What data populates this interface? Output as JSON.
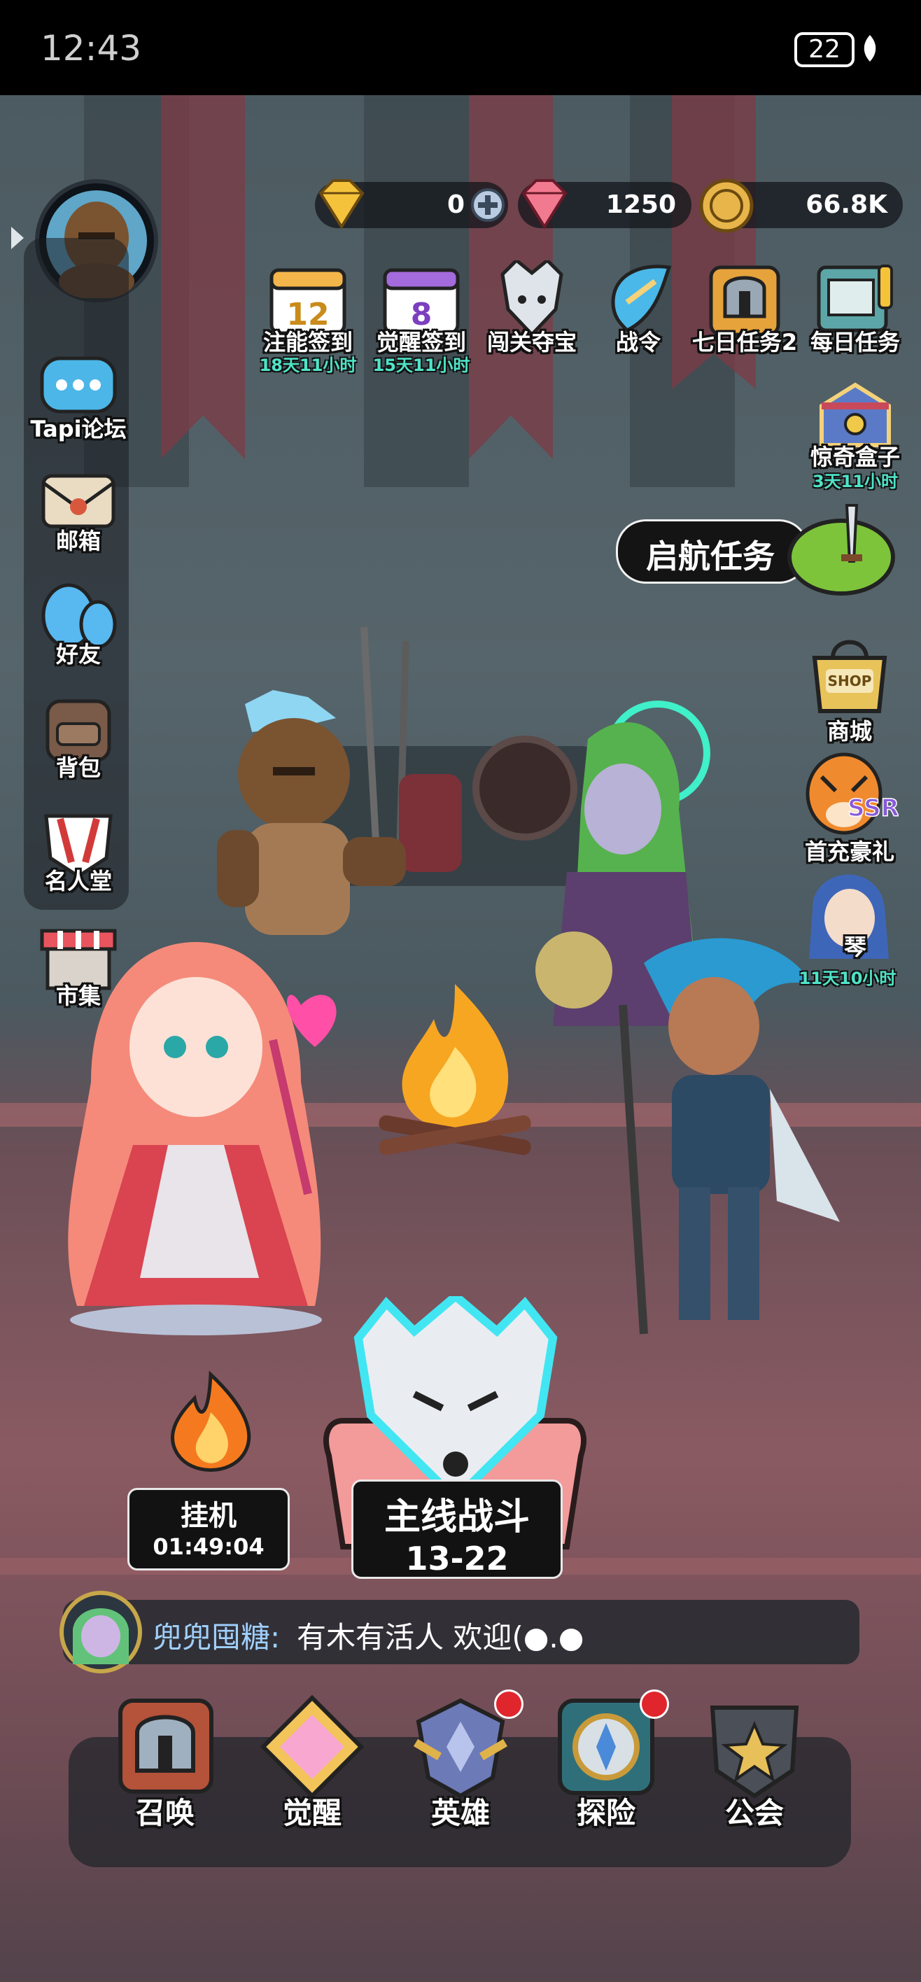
{
  "status_bar": {
    "time": "12:43",
    "battery": "22"
  },
  "currency": {
    "gold_value": "0",
    "diamond_value": "1250",
    "coin_value": "66.8K"
  },
  "top_events": [
    {
      "label": "注能签到",
      "sub": "18天11小时"
    },
    {
      "label": "觉醒签到",
      "sub": "15天11小时"
    },
    {
      "label": "闯关夺宝",
      "sub": ""
    },
    {
      "label": "战令",
      "sub": ""
    },
    {
      "label": "七日任务2",
      "sub": ""
    },
    {
      "label": "每日任务",
      "sub": ""
    }
  ],
  "left_menu": [
    {
      "label": "Tapi论坛"
    },
    {
      "label": "邮箱"
    },
    {
      "label": "好友"
    },
    {
      "label": "背包"
    },
    {
      "label": "名人堂"
    },
    {
      "label": "市集"
    }
  ],
  "right_menu": {
    "surprise_box": {
      "label": "惊奇盒子",
      "sub": "3天11小时"
    },
    "quest": {
      "label": "启航任务"
    },
    "shop": {
      "label": "商城",
      "badge": "SHOP"
    },
    "first_recharge": {
      "label": "首充豪礼",
      "badge": "SSR"
    },
    "qin": {
      "label": "琴",
      "sub": "11天10小时"
    }
  },
  "idle": {
    "label": "挂机",
    "timer": "01:49:04"
  },
  "main_battle": {
    "label": "主线战斗",
    "stage": "13-22"
  },
  "chat": {
    "name": "兜兜囤糖:",
    "message": "有木有活人 欢迎(●.●"
  },
  "bottom_nav": [
    {
      "label": "召唤",
      "dot": false
    },
    {
      "label": "觉醒",
      "dot": false
    },
    {
      "label": "英雄",
      "dot": true
    },
    {
      "label": "探险",
      "dot": true
    },
    {
      "label": "公会",
      "dot": false
    }
  ],
  "colors": {
    "accent_teal": "#4fe3c7",
    "chat_name": "#9fd0ff",
    "red_dot": "#e0262c"
  }
}
